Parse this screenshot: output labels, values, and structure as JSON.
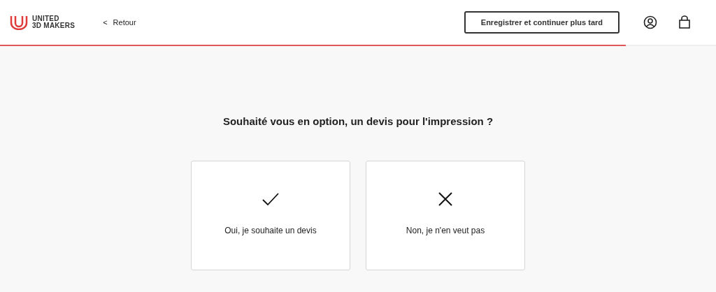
{
  "header": {
    "logo_lines": [
      "UNITED",
      "3D MAKERS"
    ],
    "back": {
      "arrow": "<",
      "label": "Retour"
    },
    "save_button": "Enregistrer et continuer plus tard"
  },
  "progress": {
    "level": 0.874
  },
  "question": "Souhaité vous en option, un devis pour l'impression ?",
  "options": [
    {
      "kind": "check",
      "label": "Oui, je souhaite un devis"
    },
    {
      "kind": "cross",
      "label": "Non, je n'en veut pas"
    }
  ]
}
